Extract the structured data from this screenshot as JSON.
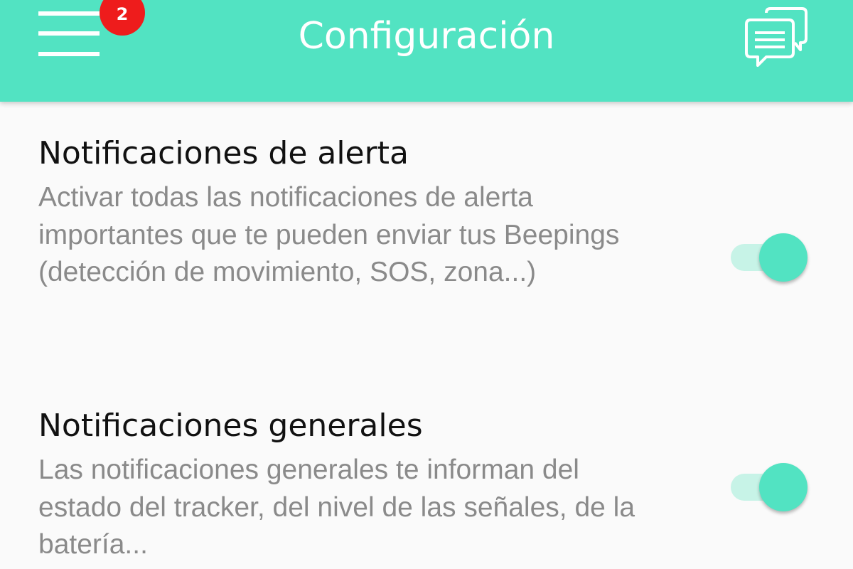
{
  "header": {
    "title": "Configuración",
    "menu_icon": "hamburger-menu-icon",
    "notification_count": "2",
    "chat_icon": "chat-bubbles-icon"
  },
  "settings": [
    {
      "title": "Notificaciones de alerta",
      "description": "Activar todas las notificaciones de alerta importantes que te pueden enviar tus Beepings (detección de movimiento, SOS, zona...)",
      "enabled": true
    },
    {
      "title": "Notificaciones generales",
      "description": "Las notificaciones generales te informan del estado del tracker, del nivel de las señales, de la batería...",
      "enabled": true
    }
  ],
  "colors": {
    "accent": "#52e3c2",
    "toggle_track": "#c7f3e7",
    "badge": "#ee1c1c",
    "title_text": "#111111",
    "description_text": "#8a8a8a",
    "background": "#fafafa"
  }
}
